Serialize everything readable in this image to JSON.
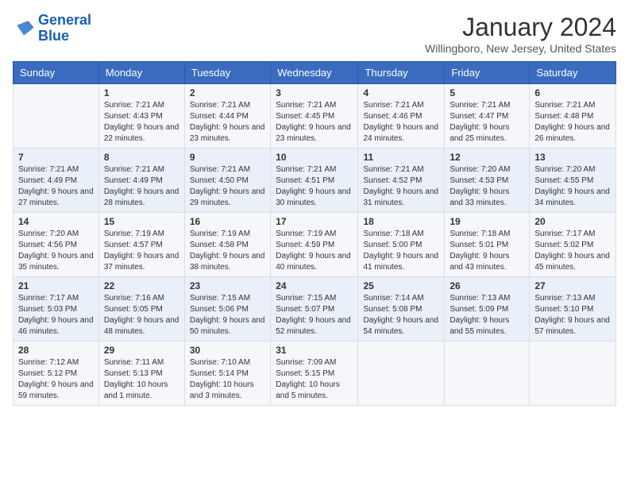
{
  "logo": {
    "name_part1": "General",
    "name_part2": "Blue"
  },
  "title": "January 2024",
  "location": "Willingboro, New Jersey, United States",
  "days_of_week": [
    "Sunday",
    "Monday",
    "Tuesday",
    "Wednesday",
    "Thursday",
    "Friday",
    "Saturday"
  ],
  "weeks": [
    [
      {
        "day": "",
        "sunrise": "",
        "sunset": "",
        "daylight": ""
      },
      {
        "day": "1",
        "sunrise": "Sunrise: 7:21 AM",
        "sunset": "Sunset: 4:43 PM",
        "daylight": "Daylight: 9 hours and 22 minutes."
      },
      {
        "day": "2",
        "sunrise": "Sunrise: 7:21 AM",
        "sunset": "Sunset: 4:44 PM",
        "daylight": "Daylight: 9 hours and 23 minutes."
      },
      {
        "day": "3",
        "sunrise": "Sunrise: 7:21 AM",
        "sunset": "Sunset: 4:45 PM",
        "daylight": "Daylight: 9 hours and 23 minutes."
      },
      {
        "day": "4",
        "sunrise": "Sunrise: 7:21 AM",
        "sunset": "Sunset: 4:46 PM",
        "daylight": "Daylight: 9 hours and 24 minutes."
      },
      {
        "day": "5",
        "sunrise": "Sunrise: 7:21 AM",
        "sunset": "Sunset: 4:47 PM",
        "daylight": "Daylight: 9 hours and 25 minutes."
      },
      {
        "day": "6",
        "sunrise": "Sunrise: 7:21 AM",
        "sunset": "Sunset: 4:48 PM",
        "daylight": "Daylight: 9 hours and 26 minutes."
      }
    ],
    [
      {
        "day": "7",
        "sunrise": "Sunrise: 7:21 AM",
        "sunset": "Sunset: 4:49 PM",
        "daylight": "Daylight: 9 hours and 27 minutes."
      },
      {
        "day": "8",
        "sunrise": "Sunrise: 7:21 AM",
        "sunset": "Sunset: 4:49 PM",
        "daylight": "Daylight: 9 hours and 28 minutes."
      },
      {
        "day": "9",
        "sunrise": "Sunrise: 7:21 AM",
        "sunset": "Sunset: 4:50 PM",
        "daylight": "Daylight: 9 hours and 29 minutes."
      },
      {
        "day": "10",
        "sunrise": "Sunrise: 7:21 AM",
        "sunset": "Sunset: 4:51 PM",
        "daylight": "Daylight: 9 hours and 30 minutes."
      },
      {
        "day": "11",
        "sunrise": "Sunrise: 7:21 AM",
        "sunset": "Sunset: 4:52 PM",
        "daylight": "Daylight: 9 hours and 31 minutes."
      },
      {
        "day": "12",
        "sunrise": "Sunrise: 7:20 AM",
        "sunset": "Sunset: 4:53 PM",
        "daylight": "Daylight: 9 hours and 33 minutes."
      },
      {
        "day": "13",
        "sunrise": "Sunrise: 7:20 AM",
        "sunset": "Sunset: 4:55 PM",
        "daylight": "Daylight: 9 hours and 34 minutes."
      }
    ],
    [
      {
        "day": "14",
        "sunrise": "Sunrise: 7:20 AM",
        "sunset": "Sunset: 4:56 PM",
        "daylight": "Daylight: 9 hours and 35 minutes."
      },
      {
        "day": "15",
        "sunrise": "Sunrise: 7:19 AM",
        "sunset": "Sunset: 4:57 PM",
        "daylight": "Daylight: 9 hours and 37 minutes."
      },
      {
        "day": "16",
        "sunrise": "Sunrise: 7:19 AM",
        "sunset": "Sunset: 4:58 PM",
        "daylight": "Daylight: 9 hours and 38 minutes."
      },
      {
        "day": "17",
        "sunrise": "Sunrise: 7:19 AM",
        "sunset": "Sunset: 4:59 PM",
        "daylight": "Daylight: 9 hours and 40 minutes."
      },
      {
        "day": "18",
        "sunrise": "Sunrise: 7:18 AM",
        "sunset": "Sunset: 5:00 PM",
        "daylight": "Daylight: 9 hours and 41 minutes."
      },
      {
        "day": "19",
        "sunrise": "Sunrise: 7:18 AM",
        "sunset": "Sunset: 5:01 PM",
        "daylight": "Daylight: 9 hours and 43 minutes."
      },
      {
        "day": "20",
        "sunrise": "Sunrise: 7:17 AM",
        "sunset": "Sunset: 5:02 PM",
        "daylight": "Daylight: 9 hours and 45 minutes."
      }
    ],
    [
      {
        "day": "21",
        "sunrise": "Sunrise: 7:17 AM",
        "sunset": "Sunset: 5:03 PM",
        "daylight": "Daylight: 9 hours and 46 minutes."
      },
      {
        "day": "22",
        "sunrise": "Sunrise: 7:16 AM",
        "sunset": "Sunset: 5:05 PM",
        "daylight": "Daylight: 9 hours and 48 minutes."
      },
      {
        "day": "23",
        "sunrise": "Sunrise: 7:15 AM",
        "sunset": "Sunset: 5:06 PM",
        "daylight": "Daylight: 9 hours and 50 minutes."
      },
      {
        "day": "24",
        "sunrise": "Sunrise: 7:15 AM",
        "sunset": "Sunset: 5:07 PM",
        "daylight": "Daylight: 9 hours and 52 minutes."
      },
      {
        "day": "25",
        "sunrise": "Sunrise: 7:14 AM",
        "sunset": "Sunset: 5:08 PM",
        "daylight": "Daylight: 9 hours and 54 minutes."
      },
      {
        "day": "26",
        "sunrise": "Sunrise: 7:13 AM",
        "sunset": "Sunset: 5:09 PM",
        "daylight": "Daylight: 9 hours and 55 minutes."
      },
      {
        "day": "27",
        "sunrise": "Sunrise: 7:13 AM",
        "sunset": "Sunset: 5:10 PM",
        "daylight": "Daylight: 9 hours and 57 minutes."
      }
    ],
    [
      {
        "day": "28",
        "sunrise": "Sunrise: 7:12 AM",
        "sunset": "Sunset: 5:12 PM",
        "daylight": "Daylight: 9 hours and 59 minutes."
      },
      {
        "day": "29",
        "sunrise": "Sunrise: 7:11 AM",
        "sunset": "Sunset: 5:13 PM",
        "daylight": "Daylight: 10 hours and 1 minute."
      },
      {
        "day": "30",
        "sunrise": "Sunrise: 7:10 AM",
        "sunset": "Sunset: 5:14 PM",
        "daylight": "Daylight: 10 hours and 3 minutes."
      },
      {
        "day": "31",
        "sunrise": "Sunrise: 7:09 AM",
        "sunset": "Sunset: 5:15 PM",
        "daylight": "Daylight: 10 hours and 5 minutes."
      },
      {
        "day": "",
        "sunrise": "",
        "sunset": "",
        "daylight": ""
      },
      {
        "day": "",
        "sunrise": "",
        "sunset": "",
        "daylight": ""
      },
      {
        "day": "",
        "sunrise": "",
        "sunset": "",
        "daylight": ""
      }
    ]
  ]
}
